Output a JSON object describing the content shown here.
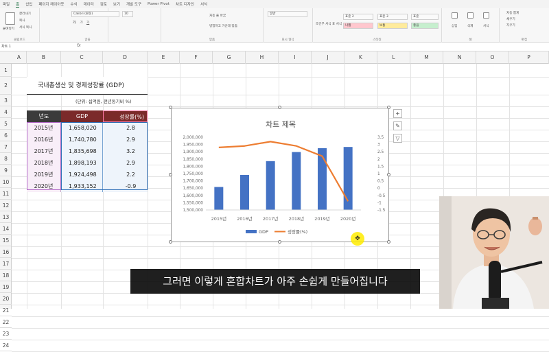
{
  "ribbon_tabs": [
    "파일",
    "홈",
    "삽입",
    "페이지 레이아웃",
    "수식",
    "데이터",
    "검토",
    "보기",
    "개발 도구",
    "Power Pivot",
    "차트 디자인",
    "서식"
  ],
  "ribbon": {
    "clipboard": {
      "paste": "붙여넣기",
      "cut": "잘라내기",
      "copy": "복사",
      "format_painter": "서식 복사",
      "label": "클립보드"
    },
    "font": {
      "name": "Calibri (본문)",
      "size": "10",
      "label": "글꼴"
    },
    "alignment": {
      "wrap": "자동 줄 바꿈",
      "merge": "병합하고 가운데 맞춤",
      "label": "맞춤"
    },
    "number": {
      "format": "일반",
      "label": "표시 형식"
    },
    "styles": {
      "conditional": "조건부 서식",
      "table": "표 서식",
      "normal2": "표준 2",
      "normal3": "표준 3",
      "normal": "표준",
      "bad": "나쁨",
      "good": "보통",
      "neutral": "좋음",
      "label": "스타일"
    },
    "cells": {
      "insert": "삽입",
      "delete": "삭제",
      "format": "서식",
      "label": "셀"
    },
    "editing": {
      "autosum": "자동 합계",
      "fill": "채우기",
      "clear": "지우기",
      "sort": "정렬 및 필터",
      "find": "찾기 및 선택",
      "label": "편집"
    }
  },
  "formula_bar": {
    "name_box": "차트 1",
    "fx": "fx",
    "value": ""
  },
  "columns": [
    "A",
    "B",
    "C",
    "D",
    "E",
    "F",
    "G",
    "H",
    "I",
    "J",
    "K",
    "L",
    "M",
    "N",
    "O",
    "P"
  ],
  "rows": [
    "1",
    "2",
    "3",
    "4",
    "5",
    "6",
    "7",
    "8",
    "9",
    "10",
    "11",
    "12",
    "13",
    "14",
    "15",
    "16",
    "17",
    "18",
    "19",
    "20",
    "21",
    "22",
    "23",
    "24"
  ],
  "sheet": {
    "title": "국내총생산 및 경제성장률 (GDP)",
    "unit_note": "(단위: 십억원, 전년동기비 %)",
    "headers": [
      "년도",
      "GDP",
      "성장률(%)"
    ],
    "data": [
      [
        "2015년",
        "1,658,020",
        "2.8"
      ],
      [
        "2016년",
        "1,740,780",
        "2.9"
      ],
      [
        "2017년",
        "1,835,698",
        "3.2"
      ],
      [
        "2018년",
        "1,898,193",
        "2.9"
      ],
      [
        "2019년",
        "1,924,498",
        "2.2"
      ],
      [
        "2020년",
        "1,933,152",
        "-0.9"
      ]
    ]
  },
  "chart_data": {
    "type": "bar",
    "title": "차트 제목",
    "categories": [
      "2015년",
      "2016년",
      "2017년",
      "2018년",
      "2019년",
      "2020년"
    ],
    "series": [
      {
        "name": "GDP",
        "type": "bar",
        "axis": "left",
        "color": "#4472c4",
        "values": [
          1658020,
          1740780,
          1835698,
          1898193,
          1924498,
          1933152
        ]
      },
      {
        "name": "성장률(%)",
        "type": "line",
        "axis": "right",
        "color": "#ed7d31",
        "values": [
          2.8,
          2.9,
          3.2,
          2.9,
          2.2,
          -0.9
        ]
      }
    ],
    "y_left": {
      "min": 1500000,
      "max": 2000000,
      "ticks": [
        "1,500,000",
        "1,550,000",
        "1,600,000",
        "1,650,000",
        "1,700,000",
        "1,750,000",
        "1,800,000",
        "1,850,000",
        "1,900,000",
        "1,950,000",
        "2,000,000"
      ]
    },
    "y_right": {
      "min": -1.5,
      "max": 3.5,
      "ticks": [
        "-1.5",
        "-1",
        "-0.5",
        "0",
        "0.5",
        "1",
        "1.5",
        "2",
        "2.5",
        "3",
        "3.5"
      ]
    },
    "legend": "bottom",
    "grid": false
  },
  "subtitle": "그러면 이렇게 혼합차트가 아주 손쉽게 만들어집니다",
  "chart_side_buttons": [
    "+",
    "✎",
    "▽"
  ],
  "colors": {
    "accent": "#217346",
    "table_header_dark": "#3b3b3b",
    "table_header_red": "#7b2a2a"
  }
}
